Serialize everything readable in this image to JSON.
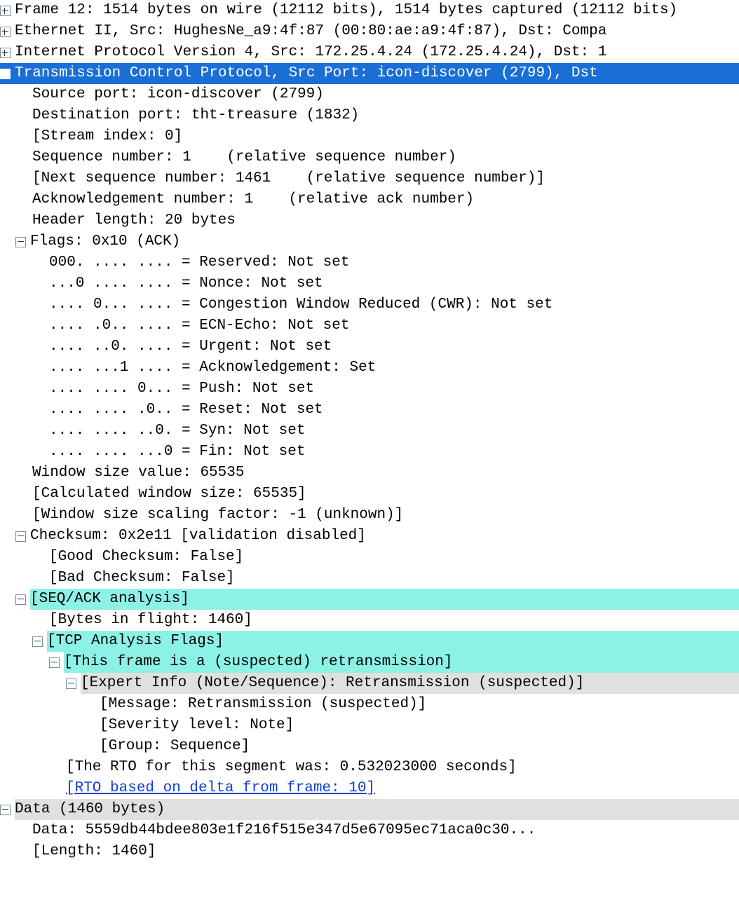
{
  "r": {
    "frame": "Frame 12: 1514 bytes on wire (12112 bits), 1514 bytes captured (12112 bits)",
    "eth": "Ethernet II, Src: HughesNe_a9:4f:87 (00:80:ae:a9:4f:87), Dst: Compa",
    "ip": "Internet Protocol Version 4, Src: 172.25.4.24 (172.25.4.24), Dst: 1",
    "tcp": "Transmission Control Protocol, Src Port: icon-discover (2799), Dst ",
    "srcport": "Source port: icon-discover (2799)",
    "dstport": "Destination port: tht-treasure (1832)",
    "stream": "[Stream index: 0]",
    "seq": "Sequence number: 1    (relative sequence number)",
    "nextseq": "[Next sequence number: 1461    (relative sequence number)]",
    "ack": "Acknowledgement number: 1    (relative ack number)",
    "hdrlen": "Header length: 20 bytes",
    "flags": "Flags: 0x10 (ACK)",
    "f_res": "000. .... .... = Reserved: Not set",
    "f_nonce": "...0 .... .... = Nonce: Not set",
    "f_cwr": ".... 0... .... = Congestion Window Reduced (CWR): Not set",
    "f_ecn": ".... .0.. .... = ECN-Echo: Not set",
    "f_urg": ".... ..0. .... = Urgent: Not set",
    "f_ack": ".... ...1 .... = Acknowledgement: Set",
    "f_push": ".... .... 0... = Push: Not set",
    "f_reset": ".... .... .0.. = Reset: Not set",
    "f_syn": ".... .... ..0. = Syn: Not set",
    "f_fin": ".... .... ...0 = Fin: Not set",
    "win": "Window size value: 65535",
    "calcwin": "[Calculated window size: 65535]",
    "winscale": "[Window size scaling factor: -1 (unknown)]",
    "chksum": "Checksum: 0x2e11 [validation disabled]",
    "goodcs": "[Good Checksum: False]",
    "badcs": "[Bad Checksum: False]",
    "seqack": "[SEQ/ACK analysis]",
    "bif": "[Bytes in flight: 1460]",
    "tcpan": "[TCP Analysis Flags]",
    "retx": "[This frame is a (suspected) retransmission]",
    "expert": "[Expert Info (Note/Sequence): Retransmission (suspected)]",
    "msg": "[Message: Retransmission (suspected)]",
    "sev": "[Severity level: Note]",
    "group": "[Group: Sequence]",
    "rto": "[The RTO for this segment was: 0.532023000 seconds]",
    "rtolink": "[RTO based on delta from frame: 10]",
    "data": "Data (1460 bytes)",
    "datahex": "Data: 5559db44bdee803e1f216f515e347d5e67095ec71aca0c30...",
    "datalen": "[Length: 1460]"
  }
}
